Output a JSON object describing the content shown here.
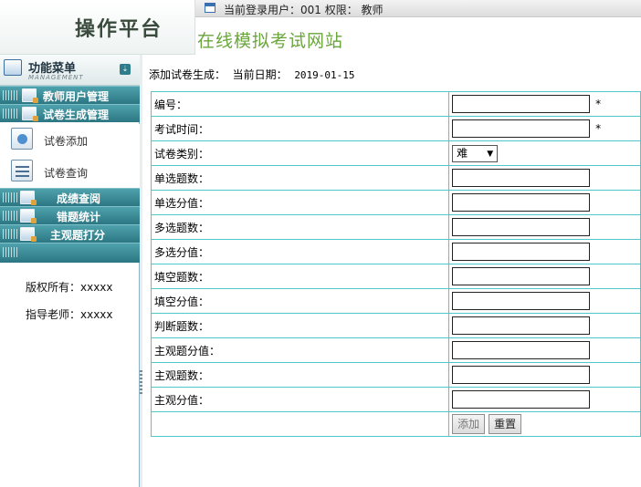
{
  "header": {
    "logo_title": "操作平台",
    "user_line": "当前登录用户：001 权限： 教师",
    "site_title": "在线模拟考试网站"
  },
  "sidebar": {
    "menu_title": "功能菜单",
    "menu_subtitle": "MANAGEMENT",
    "sections": [
      {
        "label": "教师用户管理"
      },
      {
        "label": "试卷生成管理"
      }
    ],
    "sub_items": [
      {
        "label": "试卷添加"
      },
      {
        "label": "试卷查询"
      }
    ],
    "more_sections": [
      {
        "label": "成绩查阅"
      },
      {
        "label": "错题统计"
      },
      {
        "label": "主观题打分"
      }
    ],
    "copyright": "版权所有：xxxxx",
    "advisor": "指导老师：xxxxx"
  },
  "main": {
    "crumb_prefix": "添加试卷生成：",
    "date_label": "当前日期：",
    "date_value": "2019-01-15",
    "fields": [
      {
        "label": "编号：",
        "required_mark": "*"
      },
      {
        "label": "考试时间：",
        "required_mark": "*"
      },
      {
        "label": "试卷类别：",
        "select_value": "难"
      },
      {
        "label": "单选题数："
      },
      {
        "label": "单选分值："
      },
      {
        "label": "多选题数："
      },
      {
        "label": "多选分值："
      },
      {
        "label": "填空题数："
      },
      {
        "label": "填空分值："
      },
      {
        "label": "判断题数："
      },
      {
        "label": "主观题分值："
      },
      {
        "label": "主观题数："
      },
      {
        "label": "主观分值："
      }
    ],
    "add_button": "添加",
    "reset_button": "重置"
  },
  "colors": {
    "menu_bar": "#3a8a96",
    "table_border": "#50c8c8",
    "site_title": "#6aa63c"
  }
}
